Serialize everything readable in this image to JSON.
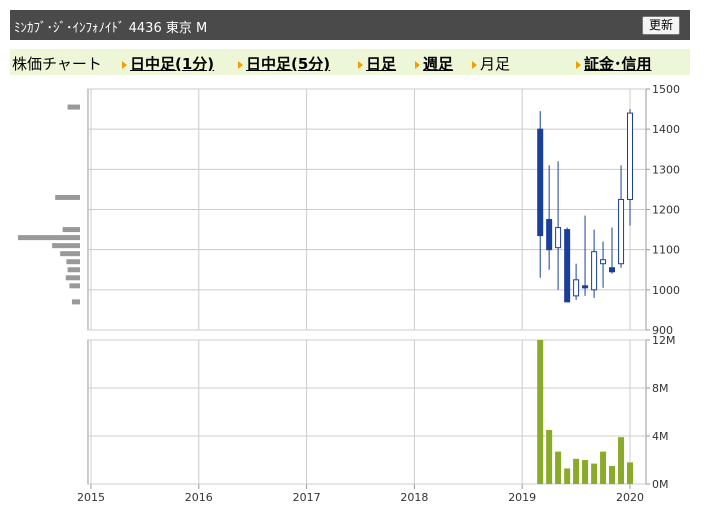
{
  "header": {
    "title": "ﾐﾝｶﾌﾞ･ｼﾞ･ｲﾝﾌｫﾉｲﾄﾞ  4436  東京 M",
    "refresh_label": "更新"
  },
  "nav": {
    "label": "株価チャート",
    "items": [
      {
        "label": "日中足(1分)",
        "link": true
      },
      {
        "label": "日中足(5分)",
        "link": true
      },
      {
        "label": "日足",
        "link": true
      },
      {
        "label": "週足",
        "link": true
      },
      {
        "label": "月足",
        "link": false
      },
      {
        "label": "証金･信用",
        "link": true
      }
    ]
  },
  "colors": {
    "up_candle": "#ffffff",
    "down_candle": "#1a3f9a",
    "volume_bar": "#8aaa2a",
    "profile_bar": "#999999",
    "grid": "#cccccc"
  },
  "chart_data": [
    {
      "type": "candlestick",
      "x_ticks": [
        "2015",
        "2016",
        "2017",
        "2018",
        "2019",
        "2020"
      ],
      "y_ticks": [
        "1500",
        "1400",
        "1300",
        "1200",
        "1100",
        "1000",
        "900"
      ],
      "ylim": [
        900,
        1500
      ],
      "candles": [
        {
          "x": 2019.167,
          "open": 1400,
          "high": 1445,
          "low": 1030,
          "close": 1135
        },
        {
          "x": 2019.25,
          "open": 1175,
          "high": 1310,
          "low": 1050,
          "close": 1100
        },
        {
          "x": 2019.333,
          "open": 1105,
          "high": 1320,
          "low": 1000,
          "close": 1155
        },
        {
          "x": 2019.417,
          "open": 1150,
          "high": 1155,
          "low": 970,
          "close": 970
        },
        {
          "x": 2019.5,
          "open": 985,
          "high": 1065,
          "low": 975,
          "close": 1025
        },
        {
          "x": 2019.583,
          "open": 1010,
          "high": 1185,
          "low": 985,
          "close": 1005
        },
        {
          "x": 2019.667,
          "open": 1000,
          "high": 1150,
          "low": 980,
          "close": 1095
        },
        {
          "x": 2019.75,
          "open": 1065,
          "high": 1120,
          "low": 1005,
          "close": 1075
        },
        {
          "x": 2019.833,
          "open": 1055,
          "high": 1155,
          "low": 1040,
          "close": 1045
        },
        {
          "x": 2019.917,
          "open": 1065,
          "high": 1310,
          "low": 1055,
          "close": 1225
        },
        {
          "x": 2020.0,
          "open": 1225,
          "high": 1450,
          "low": 1160,
          "close": 1440
        }
      ],
      "price_volume_profile": [
        {
          "price": 1455,
          "relative": 0.2
        },
        {
          "price": 1230,
          "relative": 0.4
        },
        {
          "price": 1150,
          "relative": 0.28
        },
        {
          "price": 1130,
          "relative": 1.0
        },
        {
          "price": 1110,
          "relative": 0.45
        },
        {
          "price": 1090,
          "relative": 0.32
        },
        {
          "price": 1070,
          "relative": 0.22
        },
        {
          "price": 1050,
          "relative": 0.2
        },
        {
          "price": 1030,
          "relative": 0.23
        },
        {
          "price": 1010,
          "relative": 0.17
        },
        {
          "price": 970,
          "relative": 0.13
        }
      ]
    },
    {
      "type": "bar",
      "y_ticks": [
        "12M",
        "8M",
        "4M",
        "0M"
      ],
      "ylim": [
        0,
        12
      ],
      "bars": [
        {
          "x": 2019.167,
          "value": 12
        },
        {
          "x": 2019.25,
          "value": 4.5
        },
        {
          "x": 2019.333,
          "value": 2.7
        },
        {
          "x": 2019.417,
          "value": 1.3
        },
        {
          "x": 2019.5,
          "value": 2.1
        },
        {
          "x": 2019.583,
          "value": 2.0
        },
        {
          "x": 2019.667,
          "value": 1.7
        },
        {
          "x": 2019.75,
          "value": 2.7
        },
        {
          "x": 2019.833,
          "value": 1.5
        },
        {
          "x": 2019.917,
          "value": 3.9
        },
        {
          "x": 2020.0,
          "value": 1.8
        }
      ]
    }
  ]
}
